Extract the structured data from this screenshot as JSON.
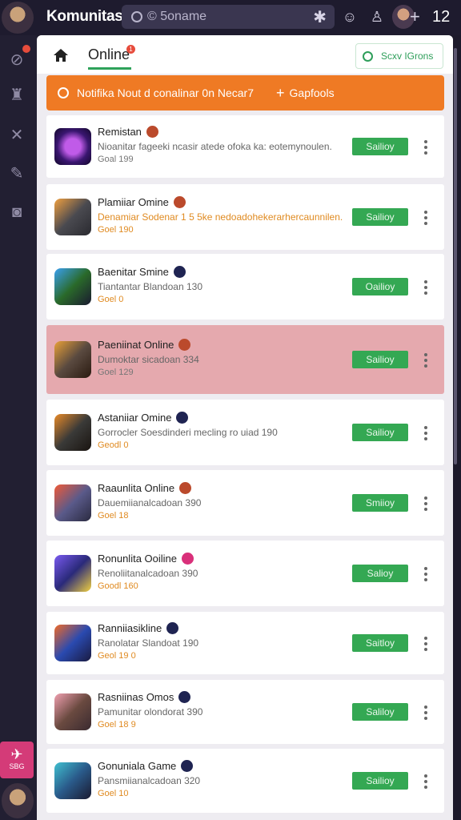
{
  "app": {
    "title": "Komunitas"
  },
  "search": {
    "placeholder": "© 5oname"
  },
  "topbar": {
    "count": "12"
  },
  "sidebar": {
    "pink_label": "SBG"
  },
  "header": {
    "tab_label": "Online",
    "tab_badge": "1",
    "search_button": "Sсxv IGrons"
  },
  "notice": {
    "text": "Notifika Nout d conalinar 0n Necar7",
    "action": "Gapfools"
  },
  "colors": {
    "accent": "#34a853",
    "notice": "#ef7a24",
    "highlight": "#e5a9ae"
  },
  "items": [
    {
      "title": "Remistan",
      "status_dot": "red",
      "subtitle": "Nioanitar fageeki ncasir atede ofoka ka: eotemynoulen.",
      "meta": "Goal 199",
      "button": "Sailioy"
    },
    {
      "title": "Plamiiar Omine",
      "status_dot": "red",
      "subtitle": "Denamiar Sodenar 1 5 5ke nedoadohekerarhercaunnilen.",
      "meta": "Goel 190",
      "button": "Sailioy"
    },
    {
      "title": "Baenitar Smine",
      "status_dot": "blue",
      "subtitle": "Tiantantar Blandoan 130",
      "meta": "Goel 0",
      "button": "Oailioy"
    },
    {
      "title": "Paeniinat Online",
      "status_dot": "red",
      "subtitle": "Dumoktar sicadoan 334",
      "meta": "Goel 129",
      "button": "Sailioy"
    },
    {
      "title": "Astaniiar Omine",
      "status_dot": "blue",
      "subtitle": "Gorrocler Soesdinderi mecling ro uiad 190",
      "meta": "Geodl 0",
      "button": "Sailioy"
    },
    {
      "title": "Raaunlita Online",
      "status_dot": "red",
      "subtitle": "Dauemiianalcadoan 390",
      "meta": "Goel 18",
      "button": "Smiioy"
    },
    {
      "title": "Ronunlita Ooiline",
      "status_dot": "pink",
      "subtitle": "Renoliitanalcadoan 390",
      "meta": "Goodl 160",
      "button": "Salioy"
    },
    {
      "title": "Ranniiasikline",
      "status_dot": "blue",
      "subtitle": "Ranolatar Slandoat 190",
      "meta": "Geol 19 0",
      "button": "Saitloy"
    },
    {
      "title": "Rasniinas Omos",
      "status_dot": "blue",
      "subtitle": "Pamunitar olondorat 390",
      "meta": "Goel 18 9",
      "button": "Saliloy"
    },
    {
      "title": "Gonuniala Game",
      "status_dot": "blue",
      "subtitle": "Pansmiianalcadoan 320",
      "meta": "Goel 10",
      "button": "Sailioy"
    }
  ]
}
